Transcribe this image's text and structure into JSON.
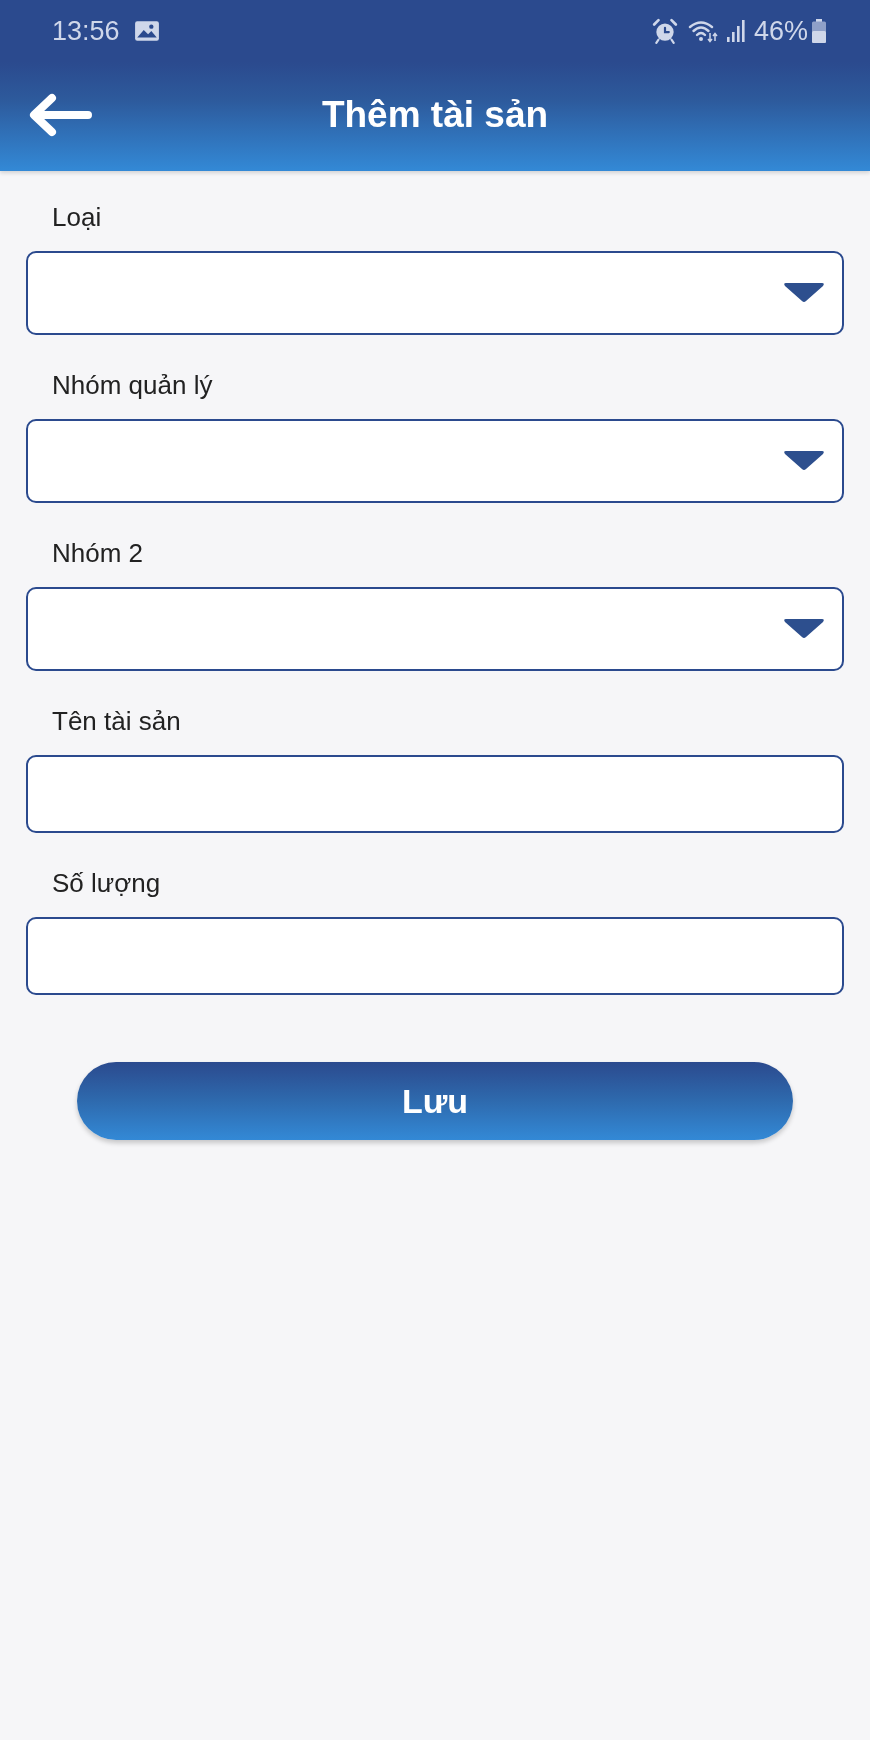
{
  "status_bar": {
    "time": "13:56",
    "battery": "46%"
  },
  "header": {
    "title": "Thêm tài sản"
  },
  "fields": [
    {
      "label": "Loại",
      "kind": "dropdown"
    },
    {
      "label": "Nhóm quản lý",
      "kind": "dropdown"
    },
    {
      "label": "Nhóm 2",
      "kind": "dropdown"
    },
    {
      "label": "Tên tài sản",
      "kind": "text"
    },
    {
      "label": "Số lượng",
      "kind": "text"
    }
  ],
  "save_button": {
    "label": "Lưu"
  }
}
